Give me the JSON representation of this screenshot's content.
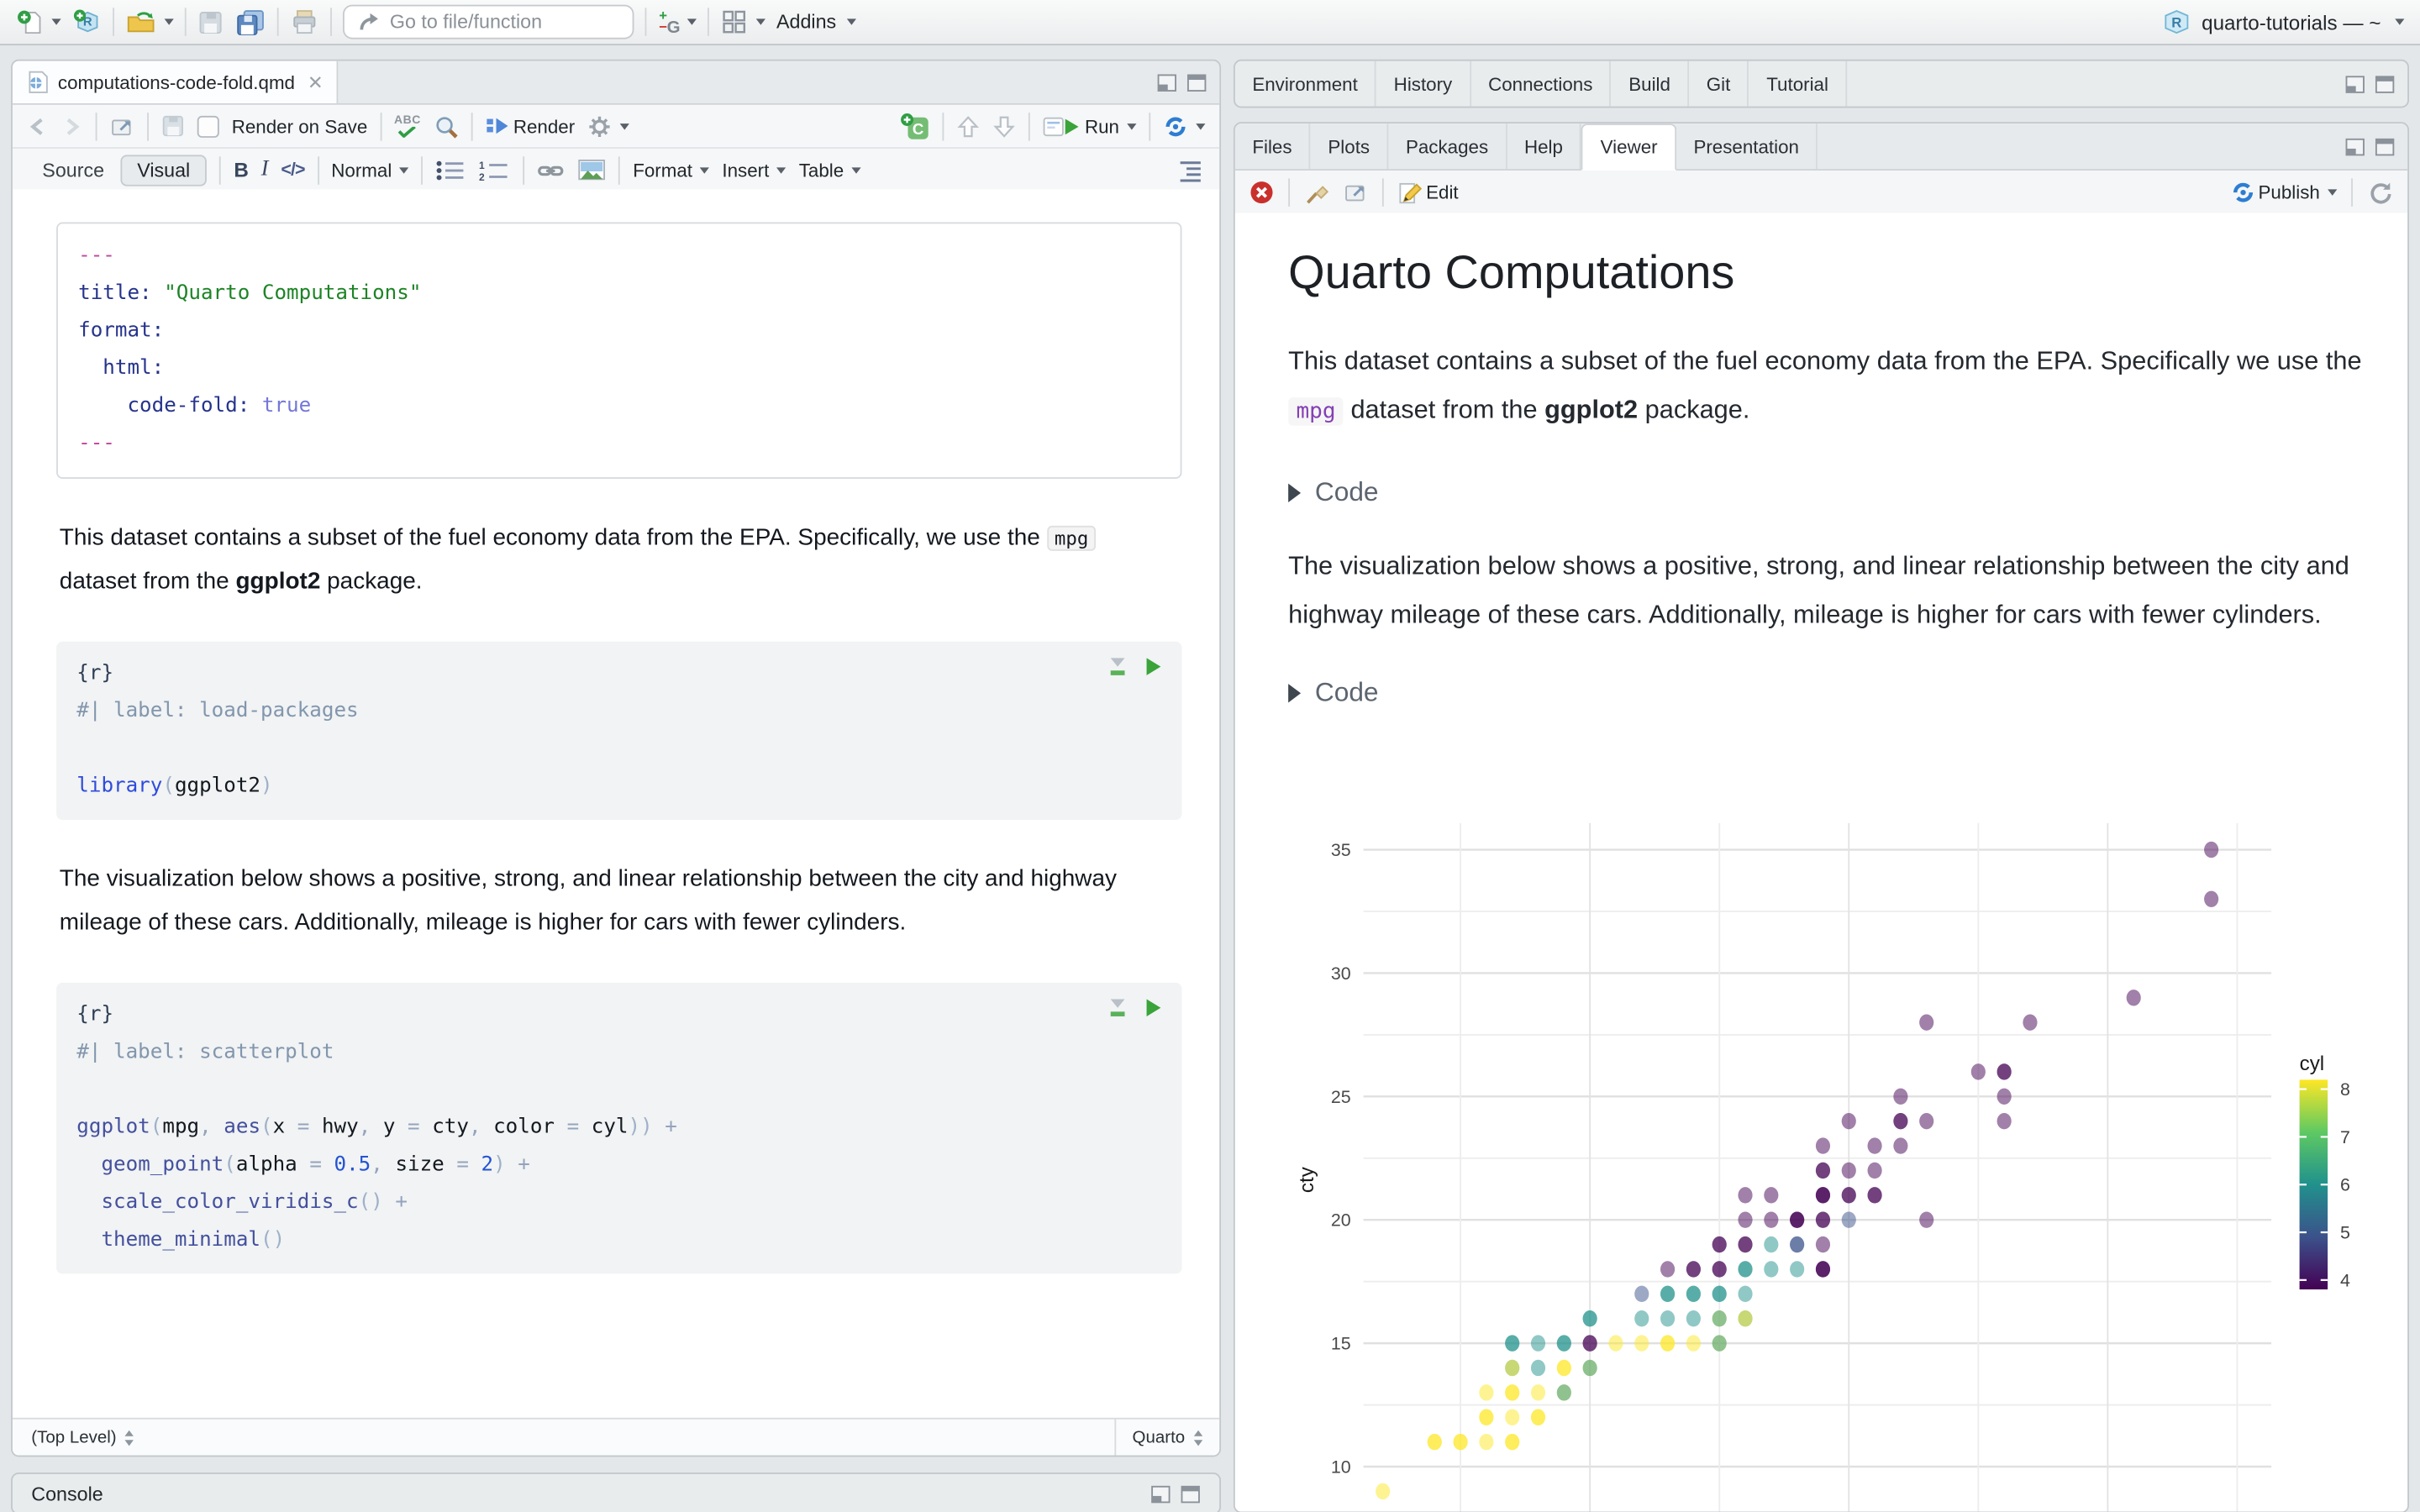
{
  "topbar": {
    "goto_placeholder": "Go to file/function",
    "addins_label": "Addins",
    "project_label": "quarto-tutorials — ~"
  },
  "editor": {
    "tab_title": "computations-code-fold.qmd",
    "toolbar": {
      "render_on_save": "Render on Save",
      "render": "Render",
      "run": "Run"
    },
    "format_bar": {
      "source": "Source",
      "visual": "Visual",
      "bold": "B",
      "italic": "I",
      "code": "</>",
      "style": "Normal",
      "format": "Format",
      "insert": "Insert",
      "table": "Table"
    },
    "yaml_lines": [
      [
        [
          "pink",
          "---"
        ]
      ],
      [
        [
          "key",
          "title:"
        ],
        [
          "plain",
          " "
        ],
        [
          "str",
          "\"Quarto Computations\""
        ]
      ],
      [
        [
          "key",
          "format:"
        ]
      ],
      [
        [
          "plain",
          "  "
        ],
        [
          "key",
          "html:"
        ]
      ],
      [
        [
          "plain",
          "    "
        ],
        [
          "key",
          "code-fold:"
        ],
        [
          "plain",
          " "
        ],
        [
          "const",
          "true"
        ]
      ],
      [
        [
          "pink",
          "---"
        ]
      ]
    ],
    "p1": {
      "pre": "This dataset contains a subset of the fuel economy data from the EPA. Specifically, we use the ",
      "code": "mpg",
      "mid": " dataset from the ",
      "bold": "ggplot2",
      "post": " package."
    },
    "chunk1_lines": [
      [
        [
          "meta",
          "{r}"
        ]
      ],
      [
        [
          "comment",
          "#| label: load-packages"
        ]
      ],
      [
        [
          "plain",
          ""
        ]
      ],
      [
        [
          "lib",
          "library"
        ],
        [
          "paren",
          "("
        ],
        [
          "id",
          "ggplot2"
        ],
        [
          "paren",
          ")"
        ]
      ]
    ],
    "p2": "The visualization below shows a positive, strong, and linear relationship between the city and highway mileage of these cars. Additionally, mileage is higher for cars with fewer cylinders.",
    "chunk2_lines": [
      [
        [
          "meta",
          "{r}"
        ]
      ],
      [
        [
          "comment",
          "#| label: scatterplot"
        ]
      ],
      [
        [
          "plain",
          ""
        ]
      ],
      [
        [
          "fn",
          "ggplot"
        ],
        [
          "paren",
          "("
        ],
        [
          "id",
          "mpg"
        ],
        [
          "op",
          ", "
        ],
        [
          "fn",
          "aes"
        ],
        [
          "paren",
          "("
        ],
        [
          "id",
          "x"
        ],
        [
          "op",
          " = "
        ],
        [
          "id",
          "hwy"
        ],
        [
          "op",
          ", "
        ],
        [
          "id",
          "y"
        ],
        [
          "op",
          " = "
        ],
        [
          "id",
          "cty"
        ],
        [
          "op",
          ", "
        ],
        [
          "id",
          "color"
        ],
        [
          "op",
          " = "
        ],
        [
          "id",
          "cyl"
        ],
        [
          "paren",
          "))"
        ],
        [
          "op",
          " +"
        ]
      ],
      [
        [
          "plain",
          "  "
        ],
        [
          "fn",
          "geom_point"
        ],
        [
          "paren",
          "("
        ],
        [
          "id",
          "alpha"
        ],
        [
          "op",
          " = "
        ],
        [
          "num",
          "0.5"
        ],
        [
          "op",
          ", "
        ],
        [
          "id",
          "size"
        ],
        [
          "op",
          " = "
        ],
        [
          "num",
          "2"
        ],
        [
          "paren",
          ")"
        ],
        [
          "op",
          " +"
        ]
      ],
      [
        [
          "plain",
          "  "
        ],
        [
          "fn",
          "scale_color_viridis_c"
        ],
        [
          "paren",
          "()"
        ],
        [
          "op",
          " +"
        ]
      ],
      [
        [
          "plain",
          "  "
        ],
        [
          "fn",
          "theme_minimal"
        ],
        [
          "paren",
          "()"
        ]
      ]
    ],
    "status_left": "(Top Level)",
    "status_right": "Quarto"
  },
  "console_label": "Console",
  "right": {
    "top_tabs": [
      "Environment",
      "History",
      "Connections",
      "Build",
      "Git",
      "Tutorial"
    ],
    "bottom_tabs": [
      "Files",
      "Plots",
      "Packages",
      "Help",
      "Viewer",
      "Presentation"
    ],
    "active_bottom_tab": "Viewer",
    "viewer_toolbar": {
      "edit": "Edit",
      "publish": "Publish"
    },
    "doc": {
      "title": "Quarto Computations",
      "p1": {
        "pre": "This dataset contains a subset of the fuel economy data from the EPA. Specifically we use the ",
        "code": "mpg",
        "mid": " dataset from the ",
        "bold": "ggplot2",
        "post": " package."
      },
      "code_fold_label": "Code",
      "p2": "The visualization below shows a positive, strong, and linear relationship between the city and highway mileage of these cars. Additionally, mileage is higher for cars with fewer cylinders."
    }
  },
  "chart_data": {
    "type": "scatter",
    "title": "",
    "ylabel": "cty",
    "xlabel": "",
    "x_field": "hwy",
    "y_field": "cty",
    "color_field": "cyl",
    "point_alpha": 0.5,
    "xlim": [
      11.5,
      45.8
    ],
    "ylim": [
      8,
      36.3
    ],
    "x_axis_labels_visible": false,
    "grid": true,
    "x_gridlines": [
      15,
      20,
      25,
      30,
      35,
      40,
      45
    ],
    "y_ticks": [
      10,
      15,
      20,
      25,
      30,
      35
    ],
    "y_minor": [
      12.5,
      17.5,
      22.5,
      27.5,
      32.5
    ],
    "legend": {
      "title": "cyl",
      "position": "right",
      "breaks": [
        8,
        7,
        6,
        5,
        4
      ],
      "gradient_top_to_bottom": [
        "#FDE725",
        "#5EC962",
        "#21918C",
        "#3B528B",
        "#440154"
      ]
    },
    "cyl_colors": {
      "4": "#440154",
      "5": "#3B528B",
      "6": "#21918C",
      "8": "#FDE725"
    },
    "points_format": [
      "hwy",
      "cty",
      "cyl",
      "overlap_count"
    ],
    "points": [
      [
        44,
        35,
        4,
        1
      ],
      [
        44,
        33,
        4,
        1
      ],
      [
        41,
        29,
        4,
        1
      ],
      [
        33,
        28,
        4,
        1
      ],
      [
        37,
        28,
        4,
        1
      ],
      [
        35,
        26,
        4,
        1
      ],
      [
        36,
        26,
        4,
        2
      ],
      [
        32,
        25,
        4,
        1
      ],
      [
        36,
        25,
        4,
        1
      ],
      [
        30,
        24,
        4,
        1
      ],
      [
        32,
        24,
        4,
        2
      ],
      [
        33,
        24,
        4,
        1
      ],
      [
        36,
        24,
        4,
        1
      ],
      [
        29,
        23,
        4,
        1
      ],
      [
        31,
        23,
        4,
        1
      ],
      [
        32,
        23,
        4,
        1
      ],
      [
        29,
        22,
        4,
        2
      ],
      [
        30,
        22,
        4,
        1
      ],
      [
        31,
        22,
        4,
        1
      ],
      [
        26,
        21,
        4,
        1
      ],
      [
        27,
        21,
        4,
        1
      ],
      [
        29,
        21,
        4,
        3
      ],
      [
        30,
        21,
        4,
        2
      ],
      [
        31,
        21,
        4,
        2
      ],
      [
        26,
        20,
        4,
        1
      ],
      [
        27,
        20,
        4,
        1
      ],
      [
        28,
        20,
        4,
        3
      ],
      [
        29,
        20,
        4,
        2
      ],
      [
        30,
        20,
        5,
        1
      ],
      [
        33,
        20,
        4,
        1
      ],
      [
        25,
        19,
        4,
        2
      ],
      [
        26,
        19,
        4,
        2
      ],
      [
        27,
        19,
        6,
        1
      ],
      [
        28,
        19,
        5,
        2
      ],
      [
        29,
        19,
        4,
        1
      ],
      [
        23,
        18,
        4,
        1
      ],
      [
        24,
        18,
        4,
        2
      ],
      [
        25,
        18,
        4,
        2
      ],
      [
        26,
        18,
        6,
        2
      ],
      [
        27,
        18,
        6,
        1
      ],
      [
        28,
        18,
        6,
        1
      ],
      [
        29,
        18,
        4,
        3
      ],
      [
        22,
        17,
        5,
        1
      ],
      [
        23,
        17,
        6,
        2
      ],
      [
        24,
        17,
        6,
        2
      ],
      [
        25,
        17,
        6,
        2
      ],
      [
        26,
        17,
        6,
        1
      ],
      [
        20,
        16,
        6,
        2
      ],
      [
        22,
        16,
        6,
        1
      ],
      [
        23,
        16,
        6,
        1
      ],
      [
        24,
        16,
        6,
        1
      ],
      [
        25,
        16,
        8,
        1
      ],
      [
        25,
        16,
        6,
        1
      ],
      [
        26,
        16,
        6,
        1
      ],
      [
        26,
        16,
        8,
        1
      ],
      [
        17,
        15,
        6,
        2
      ],
      [
        18,
        15,
        6,
        1
      ],
      [
        19,
        15,
        6,
        2
      ],
      [
        20,
        15,
        4,
        2
      ],
      [
        21,
        15,
        8,
        1
      ],
      [
        22,
        15,
        8,
        1
      ],
      [
        23,
        15,
        8,
        2
      ],
      [
        24,
        15,
        8,
        1
      ],
      [
        25,
        15,
        8,
        1
      ],
      [
        25,
        15,
        6,
        1
      ],
      [
        17,
        14,
        6,
        1
      ],
      [
        17,
        14,
        8,
        1
      ],
      [
        18,
        14,
        6,
        1
      ],
      [
        19,
        14,
        8,
        2
      ],
      [
        20,
        14,
        8,
        1
      ],
      [
        20,
        14,
        6,
        1
      ],
      [
        16,
        13,
        8,
        1
      ],
      [
        17,
        13,
        8,
        2
      ],
      [
        18,
        13,
        8,
        1
      ],
      [
        19,
        13,
        8,
        1
      ],
      [
        19,
        13,
        6,
        1
      ],
      [
        16,
        12,
        8,
        2
      ],
      [
        17,
        12,
        8,
        1
      ],
      [
        18,
        12,
        8,
        2
      ],
      [
        14,
        11,
        8,
        2
      ],
      [
        15,
        11,
        8,
        2
      ],
      [
        16,
        11,
        8,
        1
      ],
      [
        17,
        11,
        8,
        2
      ],
      [
        12,
        9,
        8,
        1
      ]
    ]
  }
}
